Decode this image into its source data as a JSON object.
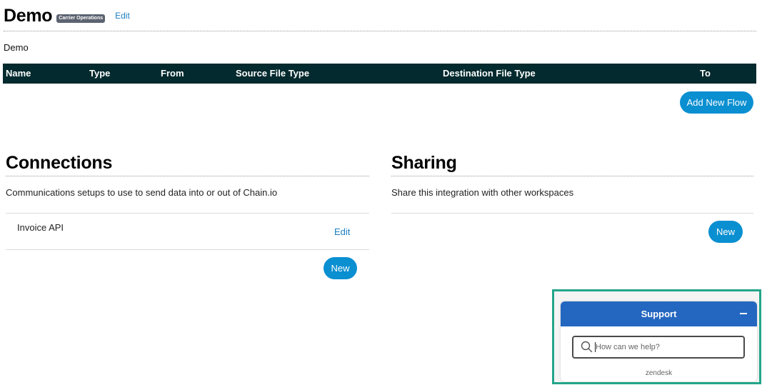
{
  "header": {
    "title": "Demo",
    "badge": "Carrier Operations",
    "edit_label": "Edit",
    "description": "Demo"
  },
  "flows_table": {
    "columns": [
      "Name",
      "Type",
      "From",
      "Source File Type",
      "Destination File Type",
      "To"
    ],
    "add_button_label": "Add New Flow"
  },
  "connections": {
    "title": "Connections",
    "description": "Communications setups to use to send data into or out of Chain.io",
    "items": [
      {
        "name": "Invoice API",
        "edit_label": "Edit"
      }
    ],
    "new_button_label": "New"
  },
  "sharing": {
    "title": "Sharing",
    "description": "Share this integration with other workspaces",
    "new_button_label": "New"
  },
  "support_widget": {
    "title": "Support",
    "search_placeholder": "How can we help?",
    "footer": "zendesk",
    "header_color": "#2467c0",
    "frame_color": "#23a58a"
  },
  "colors": {
    "table_header_bg": "#032a2e",
    "button_bg": "#0a8fd1",
    "link": "#1a7fc1"
  }
}
